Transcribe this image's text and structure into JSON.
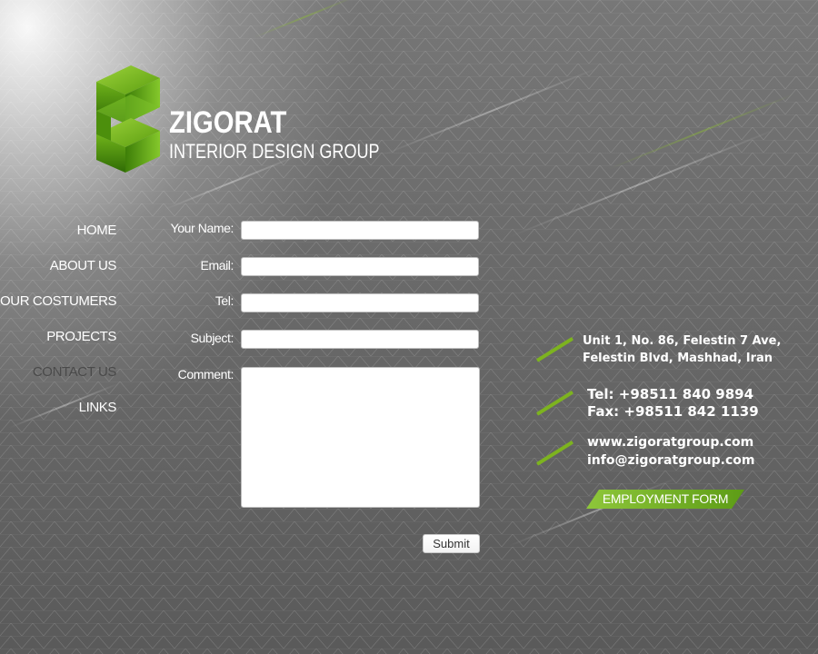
{
  "brand": {
    "name": "ZIGORAT",
    "tagline": "INTERIOR DESIGN GROUP"
  },
  "nav": {
    "items": [
      {
        "label": "HOME"
      },
      {
        "label": "ABOUT US"
      },
      {
        "label": "OUR COSTUMERS"
      },
      {
        "label": "PROJECTS"
      },
      {
        "label": "CONTACT US",
        "active": true
      },
      {
        "label": "LINKS"
      }
    ]
  },
  "form": {
    "name_label": "Your Name:",
    "name_value": "",
    "email_label": "Email:",
    "email_value": "",
    "tel_label": "Tel:",
    "tel_value": "",
    "subject_label": "Subject:",
    "subject_value": "",
    "comment_label": "Comment:",
    "comment_value": "",
    "submit_label": "Submit"
  },
  "contact": {
    "address_line1": "Unit 1, No. 86, Felestin 7 Ave,",
    "address_line2": "Felestin Blvd, Mashhad, Iran",
    "tel": "Tel: +98511 840 9894",
    "fax": "Fax: +98511 842 1139",
    "website": "www.zigoratgroup.com",
    "email": "info@zigoratgroup.com",
    "employment_label": "EMPLOYMENT FORM"
  },
  "colors": {
    "accent_green": "#7db31f",
    "active_nav": "#4a4a4a",
    "text": "#ffffff"
  }
}
